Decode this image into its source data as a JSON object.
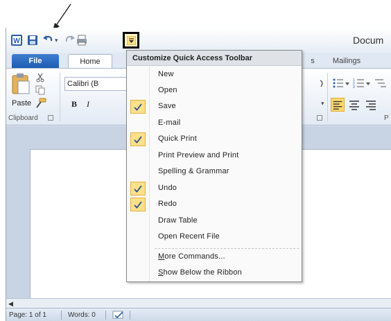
{
  "title_bar": {
    "doc_title": "Docum"
  },
  "tabs": {
    "file": "File",
    "home": "Home",
    "partial": "s",
    "mailings": "Mailings"
  },
  "ribbon": {
    "paste_label": "Paste",
    "clipboard_label": "Clipboard",
    "font_name": "Calibri (B",
    "bold": "B",
    "italic": "I",
    "paragraph_label_partial": "P"
  },
  "menu": {
    "title": "Customize Quick Access Toolbar",
    "items": [
      {
        "label": "New",
        "checked": false
      },
      {
        "label": "Open",
        "checked": false
      },
      {
        "label": "Save",
        "checked": true
      },
      {
        "label": "E-mail",
        "checked": false
      },
      {
        "label": "Quick Print",
        "checked": true
      },
      {
        "label": "Print Preview and Print",
        "checked": false
      },
      {
        "label": "Spelling & Grammar",
        "checked": false
      },
      {
        "label": "Undo",
        "checked": true
      },
      {
        "label": "Redo",
        "checked": true
      },
      {
        "label": "Draw Table",
        "checked": false
      },
      {
        "label": "Open Recent File",
        "checked": false
      }
    ],
    "more_commands_accel": "M",
    "more_commands_rest": "ore Commands...",
    "show_below_accel": "S",
    "show_below_rest": "how Below the Ribbon"
  },
  "statusbar": {
    "page": "Page: 1 of 1",
    "words": "Words: 0"
  },
  "colors": {
    "file_tab": "#2a6ac6",
    "check_highlight": "#fde08a",
    "menu_header": "#dfe3e8"
  },
  "icons": [
    "pointer-arrow",
    "word-app-icon",
    "save-icon",
    "undo-icon",
    "redo-icon",
    "quick-print-icon",
    "customize-dropdown-icon",
    "paste-icon",
    "cut-icon",
    "copy-icon",
    "format-painter-icon",
    "bullets-icon",
    "numbering-icon",
    "multilevel-list-icon",
    "align-left-icon",
    "align-center-icon",
    "align-right-icon",
    "checkmark-icon",
    "proofing-icon"
  ]
}
